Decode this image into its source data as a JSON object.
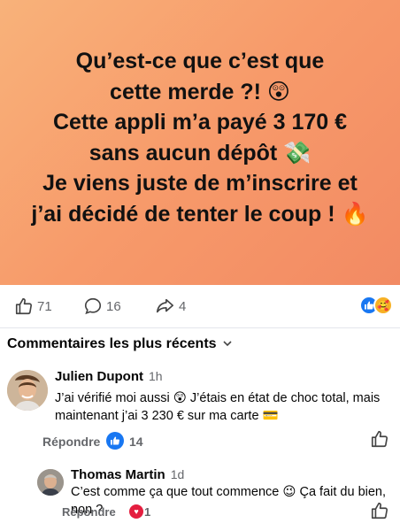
{
  "post": {
    "lines": [
      "Qu’est-ce que c’est que",
      "cette merde ?! 😲",
      "Cette appli m’a payé 3 170 €",
      "sans aucun dépôt 💸",
      "Je viens juste de m’inscrire et",
      "j’ai décidé de tenter le coup ! 🔥"
    ],
    "background_colors": [
      "#f8b27a",
      "#f28a63"
    ]
  },
  "actions": {
    "likes": "71",
    "comments": "16",
    "shares": "4"
  },
  "comments_section": {
    "title": "Commentaires les plus récents",
    "items": [
      {
        "author": "Julien Dupont",
        "time": "1h",
        "text": "J’ai vérifié moi aussi 😲 J’étais en état de choc total, mais maintenant j’ai 3 230 € sur ma carte 💳",
        "reply_label": "Répondre",
        "reaction_count": "14",
        "reaction_icon": "like-icon"
      },
      {
        "author": "Thomas Martin",
        "time": "1d",
        "text": "C’est comme ça que tout commence 😉 Ça fait du bien, non ?",
        "reply_label": "Répondre",
        "reaction_count": "1",
        "reaction_icon": "heart-icon"
      }
    ]
  }
}
